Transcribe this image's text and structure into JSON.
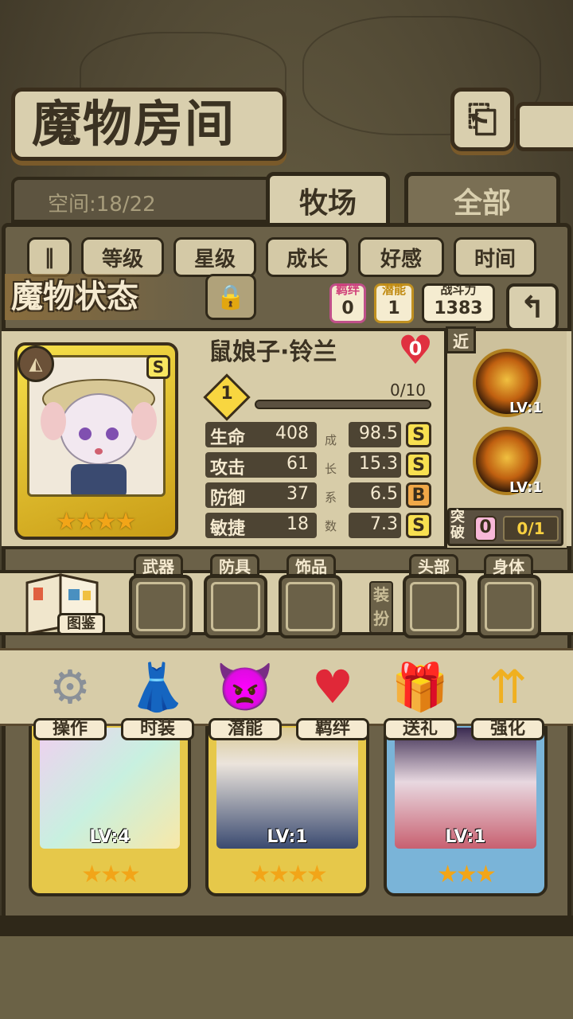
{
  "header": {
    "title": "魔物房间",
    "back_icon": "back-arrow-icon"
  },
  "space": {
    "text": "空间:18/22"
  },
  "tabs": [
    {
      "label": "牧场",
      "active": true
    },
    {
      "label": "全部",
      "active": false
    }
  ],
  "sort": {
    "toggle_icon": "pause-sort-icon",
    "buttons": [
      "等级",
      "星级",
      "成长",
      "好感",
      "时间"
    ]
  },
  "status": {
    "title": "魔物状态",
    "lock_icon": "padlock-icon",
    "bond_label": "羁绊",
    "bond_value": "0",
    "potential_label": "潜能",
    "potential_value": "1",
    "power_label": "战斗力",
    "power_value": "1383",
    "return_icon": "return-arrow-icon"
  },
  "monster": {
    "name": "鼠娘子·铃兰",
    "affection": "0",
    "element_icon": "mountain-element-icon",
    "rank": "S",
    "stars": 4,
    "level": "1",
    "exp": "0/10",
    "stats": [
      {
        "label": "生命",
        "value": "408",
        "growth": "98.5",
        "grade": "S"
      },
      {
        "label": "攻击",
        "value": "61",
        "growth": "15.3",
        "grade": "S"
      },
      {
        "label": "防御",
        "value": "37",
        "growth": "6.5",
        "grade": "B"
      },
      {
        "label": "敏捷",
        "value": "18",
        "growth": "7.3",
        "grade": "S"
      }
    ],
    "growth_chars": [
      "成",
      "长",
      "系",
      "数"
    ]
  },
  "skills": {
    "range_tag": "近",
    "items": [
      {
        "icon": "fire-strike-skill-icon",
        "level": "LV:1"
      },
      {
        "icon": "flame-swirl-skill-icon",
        "level": "LV:1"
      }
    ],
    "breakthrough_label": "突破",
    "breakthrough_count": "0",
    "breakthrough_progress": "0/1"
  },
  "equipment": {
    "book_label": "图鉴",
    "slots": [
      "武器",
      "防具",
      "饰品"
    ],
    "dress_label": "装扮",
    "dress_slots": [
      "头部",
      "身体"
    ]
  },
  "actions": [
    {
      "label": "操作",
      "icon": "gear-icon"
    },
    {
      "label": "时装",
      "icon": "outfit-icon"
    },
    {
      "label": "潜能",
      "icon": "dark-spirit-icon"
    },
    {
      "label": "羁绊",
      "icon": "hearts-icon"
    },
    {
      "label": "送礼",
      "icon": "gift-icon"
    },
    {
      "label": "强化",
      "icon": "upgrade-arrows-icon"
    }
  ],
  "roster": [
    {
      "level": "LV:4",
      "stars": 3,
      "frame": "#e6c84a",
      "portrait": "#e8d8f0"
    },
    {
      "level": "LV:1",
      "stars": 4,
      "frame": "#e6c84a",
      "portrait": "#ded8cc"
    },
    {
      "level": "LV:1",
      "stars": 3,
      "frame": "#7ab4d8",
      "portrait": "#d8d0e0"
    }
  ]
}
